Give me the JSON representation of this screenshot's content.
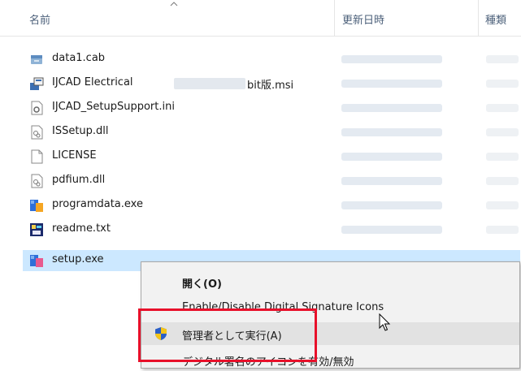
{
  "header": {
    "col_name": "名前",
    "col_modified": "更新日時",
    "col_type": "種類"
  },
  "files": [
    {
      "name": "data1.cab",
      "icon": "cab-archive-icon"
    },
    {
      "name_prefix": "IJCAD Electrical ",
      "name_suffix": "bit版.msi",
      "icon": "msi-installer-icon"
    },
    {
      "name": "IJCAD_SetupSupport.ini",
      "icon": "ini-settings-icon"
    },
    {
      "name": "ISSetup.dll",
      "icon": "dll-file-icon"
    },
    {
      "name": "LICENSE",
      "icon": "blank-file-icon"
    },
    {
      "name": "pdfium.dll",
      "icon": "dll-file-icon"
    },
    {
      "name": "programdata.exe",
      "icon": "exe-app-icon"
    },
    {
      "name": "readme.txt",
      "icon": "txt-file-icon"
    },
    {
      "name": "setup.exe",
      "icon": "exe-app-icon",
      "selected": true
    }
  ],
  "context_menu": {
    "items": [
      {
        "label": "開く(O)",
        "bold": true
      },
      {
        "label": "Enable/Disable Digital Signature Icons"
      },
      {
        "label": "管理者として実行(A)",
        "icon": "uac-shield-icon",
        "hover": true
      },
      {
        "label": "デジタル署名のアイコンを有効/無効"
      }
    ]
  },
  "colors": {
    "selected_row": "#cce8ff",
    "annotation_box": "#e8102a",
    "header_text": "#4c607a"
  }
}
